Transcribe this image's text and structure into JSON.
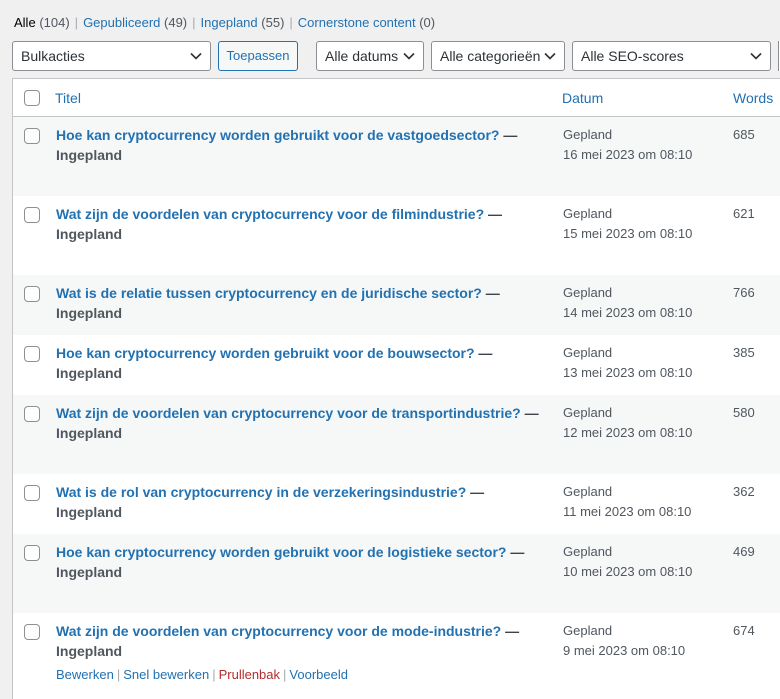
{
  "filters": [
    {
      "label": "Alle",
      "count": "(104)",
      "current": true
    },
    {
      "label": "Gepubliceerd",
      "count": "(49)",
      "current": false
    },
    {
      "label": "Ingepland",
      "count": "(55)",
      "current": false
    },
    {
      "label": "Cornerstone content",
      "count": "(0)",
      "current": false
    }
  ],
  "toolbar": {
    "bulk": "Bulkacties",
    "apply": "Toepassen",
    "dates": "Alle datums",
    "categories": "Alle categorieën",
    "seo": "Alle SEO-scores"
  },
  "columns": {
    "title": "Titel",
    "date": "Datum",
    "words": "Words"
  },
  "posts": [
    {
      "title": "Hoe kan cryptocurrency worden gebruikt voor de vastgoedsector?",
      "state": "Ingepland",
      "status": "Gepland",
      "date": "16 mei 2023 om 08:10",
      "words": "685"
    },
    {
      "title": "Wat zijn de voordelen van cryptocurrency voor de filmindustrie?",
      "state": "Ingepland",
      "status": "Gepland",
      "date": "15 mei 2023 om 08:10",
      "words": "621"
    },
    {
      "title": "Wat is de relatie tussen cryptocurrency en de juridische sector?",
      "state": "Ingepland",
      "status": "Gepland",
      "date": "14 mei 2023 om 08:10",
      "words": "766"
    },
    {
      "title": "Hoe kan cryptocurrency worden gebruikt voor de bouwsector?",
      "state": "Ingepland",
      "status": "Gepland",
      "date": "13 mei 2023 om 08:10",
      "words": "385"
    },
    {
      "title": "Wat zijn de voordelen van cryptocurrency voor de transportindustrie?",
      "state": "Ingepland",
      "status": "Gepland",
      "date": "12 mei 2023 om 08:10",
      "words": "580"
    },
    {
      "title": "Wat is de rol van cryptocurrency in de verzekeringsindustrie?",
      "state": "Ingepland",
      "status": "Gepland",
      "date": "11 mei 2023 om 08:10",
      "words": "362"
    },
    {
      "title": "Hoe kan cryptocurrency worden gebruikt voor de logistieke sector?",
      "state": "Ingepland",
      "status": "Gepland",
      "date": "10 mei 2023 om 08:10",
      "words": "469"
    },
    {
      "title": "Wat zijn de voordelen van cryptocurrency voor de mode-industrie?",
      "state": "Ingepland",
      "status": "Gepland",
      "date": "9 mei 2023 om 08:10",
      "words": "674"
    }
  ],
  "row_actions": {
    "edit": "Bewerken",
    "quick_edit": "Snel bewerken",
    "trash": "Prullenbak",
    "preview": "Voorbeeld"
  },
  "colors": {
    "link": "#2271b1",
    "trash": "#b32d2e",
    "alt_row": "#f6f7f7"
  }
}
